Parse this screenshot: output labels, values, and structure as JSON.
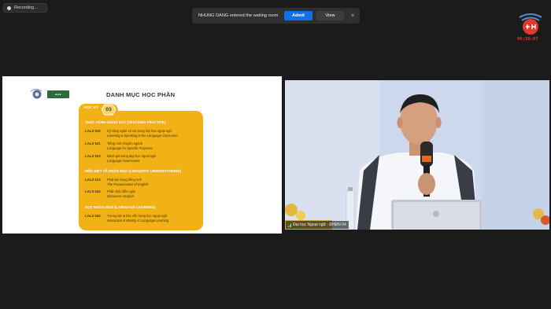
{
  "recording": {
    "label": "Recording..."
  },
  "waiting_room": {
    "message": "NHUNG DANG entered the waiting room",
    "admit_label": "Admit",
    "view_label": "View",
    "close_label": "×"
  },
  "header": {
    "time": "09:38:07",
    "logo_icon": "university-logo-icon"
  },
  "slide": {
    "title": "DANH MỤC HỌC PHẦN",
    "semester_label": "HỌC KỲ",
    "semester_number": "03",
    "sections": [
      {
        "title": "THỰC HÀNH GIẢNG DẠY (TEACHING PRACTICE)",
        "courses": [
          {
            "code": "LALS 510",
            "vi": "Kỹ năng nghe và nói trong lớp học ngoại ngữ",
            "en": "Listening & Speaking in the Language Classroom"
          },
          {
            "code": "LALS 521",
            "vi": "Tiếng Anh chuyên ngành",
            "en": "Language for Specific Purposes"
          },
          {
            "code": "LALS 523",
            "vi": "Đánh giá trong dạy-học ngoại ngữ",
            "en": "Language Assessment"
          }
        ]
      },
      {
        "title": "HIỂU BIẾT VỀ NGÔN NGỮ (LINGUISTIC UNDERSTANDING)",
        "courses": [
          {
            "code": "LALS 513",
            "vi": "Phát âm trong tiếng Anh",
            "en": "The Pronunciation of English"
          },
          {
            "code": "LALS 544",
            "vi": "Phân tích diễn ngôn",
            "en": "Discourse Analysis"
          }
        ]
      },
      {
        "title": "HỌC NGOẠI NGỮ (LANGUAGE LEARNING)",
        "courses": [
          {
            "code": "LALS 542",
            "vi": "Tương tác & bản sắc trong học ngoại ngữ",
            "en": "Interaction & Identity in Language Learning"
          }
        ]
      }
    ]
  },
  "video": {
    "participant_name": "Đại học Ngoại ngữ - ĐHĐN 04"
  },
  "colors": {
    "accent": "#0e71eb",
    "card": "#f2b215",
    "time": "#e03a2e"
  }
}
